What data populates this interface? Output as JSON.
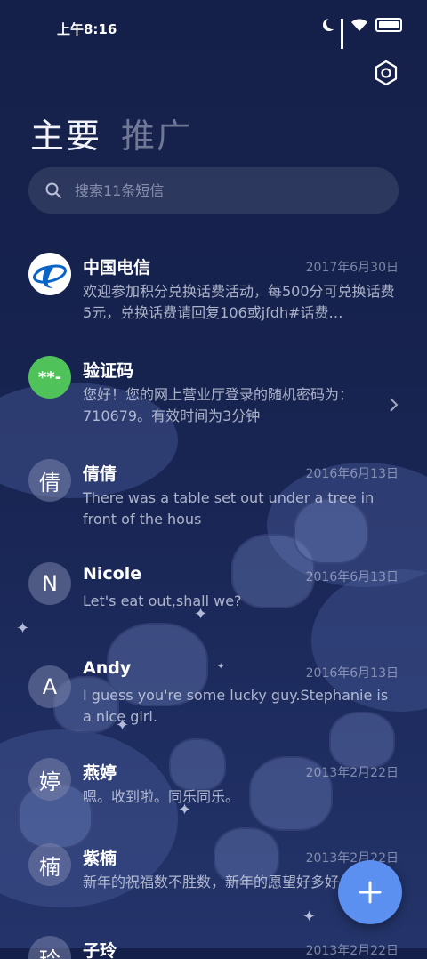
{
  "status_bar": {
    "time": "上午8:16"
  },
  "tabs": [
    {
      "label": "主要",
      "active": true
    },
    {
      "label": "推广",
      "active": false
    }
  ],
  "search": {
    "placeholder": "搜索11条短信"
  },
  "conversations": [
    {
      "name": "中国电信",
      "date": "2017年6月30日",
      "snippet": "欢迎参加积分兑换话费活动，每500分可兑换话费5元，兑换话费请回复106或jfdh#话费…",
      "avatar": "telecom-logo-icon"
    },
    {
      "name": "验证码",
      "date": "",
      "snippet": "您好！您的网上营业厅登录的随机密码为：710679。有效时间为3分钟",
      "avatar_text": "**-"
    },
    {
      "name": "倩倩",
      "date": "2016年6月13日",
      "snippet": "There was a table set out under a tree in front of the hous",
      "avatar_text": "倩"
    },
    {
      "name": "Nicole",
      "date": "2016年6月13日",
      "snippet": "Let's eat out,shall we?",
      "avatar_text": "N"
    },
    {
      "name": "Andy",
      "date": "2016年6月13日",
      "snippet": "I guess you're some lucky guy.Stephanie is a nice girl.",
      "avatar_text": "A"
    },
    {
      "name": "燕婷",
      "date": "2013年2月22日",
      "snippet": "嗯。收到啦。同乐同乐。",
      "avatar_text": "婷"
    },
    {
      "name": "紫楠",
      "date": "2013年2月22日",
      "snippet": "新年的祝福数不胜数，新年的愿望好多好多，新年的问候依旧美好，在这个温馨的时刻",
      "avatar_text": "楠"
    },
    {
      "name": "子玲",
      "date": "2013年2月22日",
      "snippet": "",
      "avatar_text": "玲"
    }
  ],
  "colors": {
    "fab": "#5b8ff0",
    "verify_avatar": "#4fc25a",
    "background": "#17234f"
  }
}
